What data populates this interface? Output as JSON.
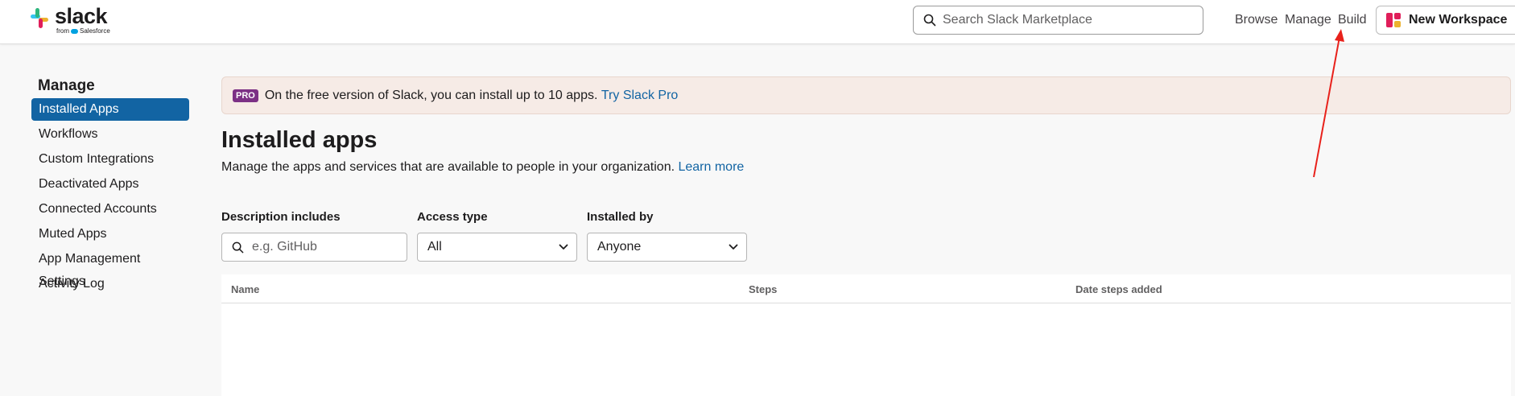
{
  "header": {
    "logo_word": "slack",
    "logo_from": "from",
    "logo_company": "Salesforce",
    "search_placeholder": "Search Slack Marketplace",
    "nav": {
      "browse": "Browse",
      "manage": "Manage",
      "build": "Build"
    },
    "workspace_button": "New Workspace"
  },
  "sidebar": {
    "title": "Manage",
    "items": [
      {
        "label": "Installed Apps",
        "active": true
      },
      {
        "label": "Workflows"
      },
      {
        "label": "Custom Integrations"
      },
      {
        "label": "Deactivated Apps"
      },
      {
        "label": "Connected Accounts"
      },
      {
        "label": "Muted Apps"
      },
      {
        "label": "App Management Settings"
      },
      {
        "label": "Activity Log"
      }
    ]
  },
  "banner": {
    "badge": "PRO",
    "text": "On the free version of Slack, you can install up to 10 apps.",
    "link": "Try Slack Pro"
  },
  "main": {
    "title": "Installed apps",
    "description": "Manage the apps and services that are available to people in your organization.",
    "learn_more": "Learn more"
  },
  "filters": {
    "description_label": "Description includes",
    "description_placeholder": "e.g. GitHub",
    "access_label": "Access type",
    "access_value": "All",
    "installed_label": "Installed by",
    "installed_value": "Anyone"
  },
  "table": {
    "columns": [
      "Name",
      "Steps",
      "Date steps added"
    ]
  },
  "colors": {
    "accent": "#1264a3",
    "pro_badge": "#7c3085",
    "banner_bg": "#f6ebe6",
    "annotation_arrow": "#e8211b"
  }
}
